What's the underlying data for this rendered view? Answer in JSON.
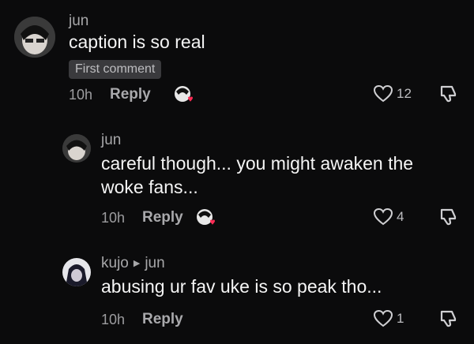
{
  "comments": [
    {
      "username": "jun",
      "text": "caption is so real",
      "badge": "First comment",
      "time": "10h",
      "reply_label": "Reply",
      "likes": "12"
    },
    {
      "username": "jun",
      "text_line1": "careful though... you might awaken the",
      "text_line2": "woke fans...",
      "time": "10h",
      "reply_label": "Reply",
      "likes": "4"
    },
    {
      "username": "kujo",
      "reply_to": "jun",
      "text": "abusing ur fav uke is so peak tho...",
      "time": "10h",
      "reply_label": "Reply",
      "likes": "1"
    }
  ],
  "icons": {
    "like": "heart-outline-icon",
    "dislike": "thumbs-down-icon",
    "creator_liked": "creator-liked-avatar-icon"
  },
  "colors": {
    "background": "#0b0b0c",
    "heart_accent": "#fe2c55"
  }
}
